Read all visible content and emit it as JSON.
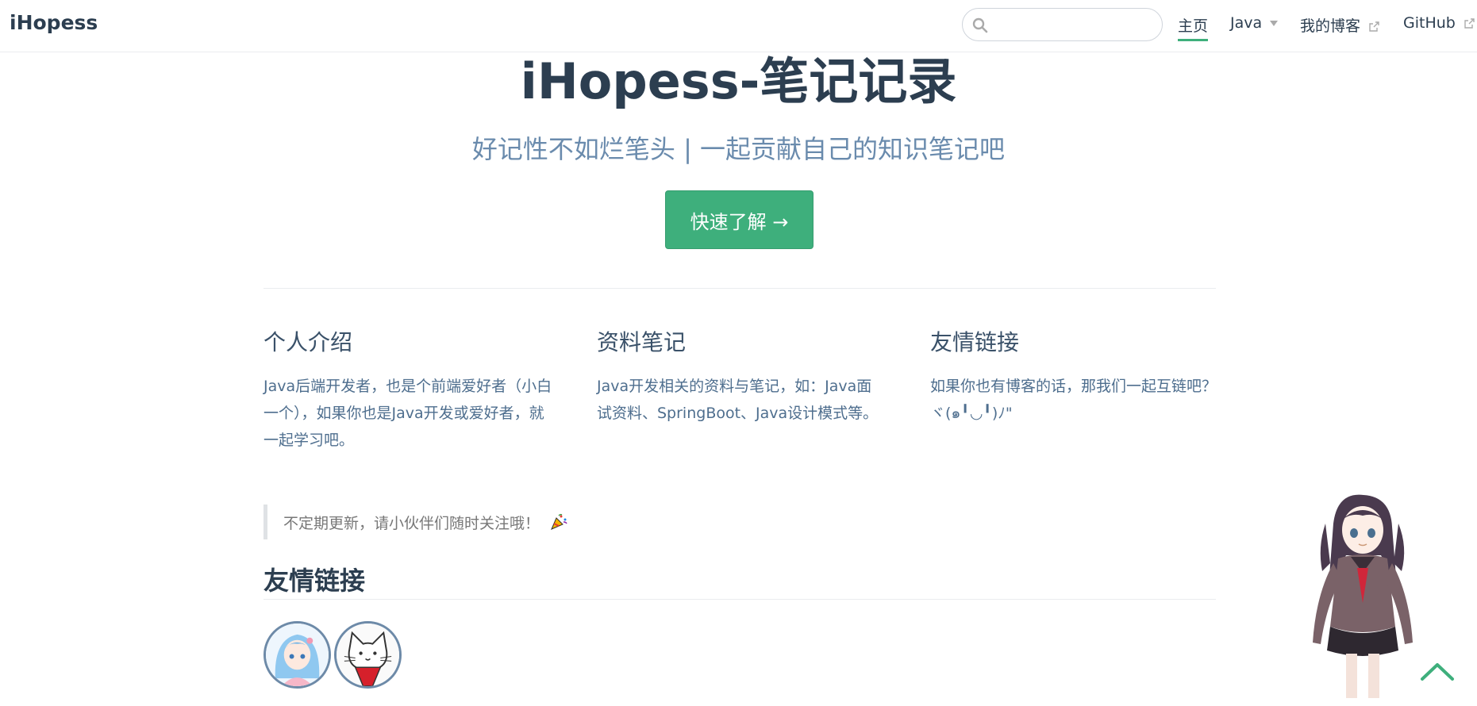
{
  "navbar": {
    "site_name": "iHopess",
    "search": {
      "value": "",
      "placeholder": ""
    },
    "links": [
      {
        "label": "主页",
        "active": true
      },
      {
        "label": "Java",
        "dropdown": true
      },
      {
        "label": "我的博客",
        "external": true
      },
      {
        "label": "GitHub",
        "external": true
      }
    ]
  },
  "hero": {
    "title": "iHopess-笔记记录",
    "description": "好记性不如烂笔头 | 一起贡献自己的知识笔记吧",
    "action_label": "快速了解 →"
  },
  "features": [
    {
      "title": "个人介绍",
      "details": "Java后端开发者，也是个前端爱好者（小白一个），如果你也是Java开发或爱好者，就一起学习吧。"
    },
    {
      "title": "资料笔记",
      "details": "Java开发相关的资料与笔记，如：Java面试资料、SpringBoot、Java设计模式等。"
    },
    {
      "title": "友情链接",
      "details": "如果你也有博客的话，那我们一起互链吧？ ヾ(๑╹◡╹)ﾉ\""
    }
  ],
  "tip": {
    "text": "不定期更新，请小伙伴们随时关注哦！"
  },
  "friend_links": {
    "heading": "友情链接",
    "avatars": [
      "anime-girl-avatar",
      "cat-avatar"
    ]
  },
  "colors": {
    "accent": "#3eaf7c",
    "text": "#2c3e50",
    "muted": "#6a8bad"
  }
}
